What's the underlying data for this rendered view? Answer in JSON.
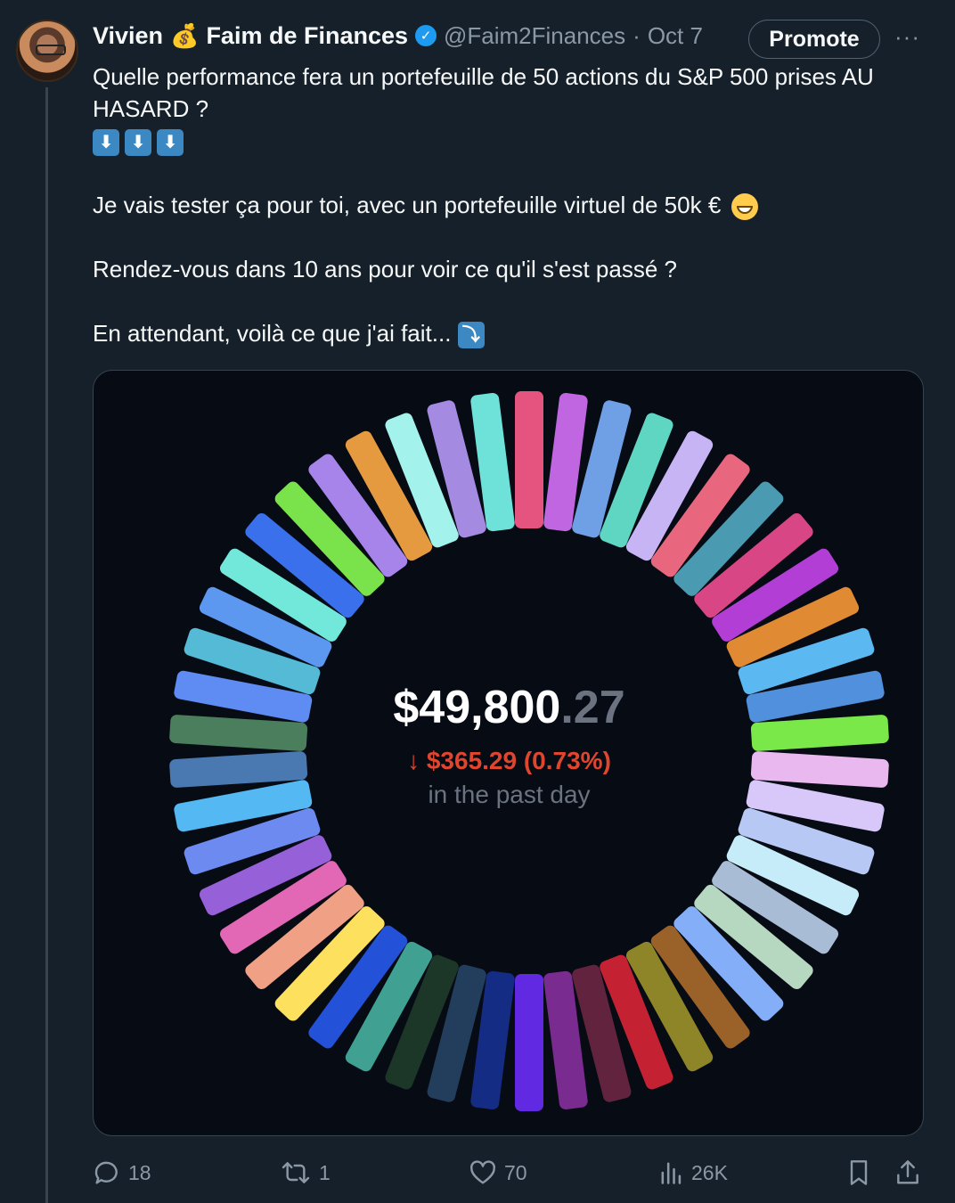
{
  "tweet": {
    "author": {
      "display_name": "Vivien",
      "brand_name": "Faim de Finances",
      "handle": "@Faim2Finances",
      "separator": "·",
      "date": "Oct 7"
    },
    "promote_label": "Promote",
    "more_label": "···",
    "text": {
      "line1": "Quelle performance fera un portefeuille de 50 actions du S&P 500 prises AU HASARD ?",
      "arrows": [
        "⬇",
        "⬇",
        "⬇"
      ],
      "line2": "Je vais tester ça pour toi, avec un portefeuille virtuel de 50k €",
      "line3": "Rendez-vous dans 10 ans pour voir ce qu'il s'est passé ?",
      "line4": "En attendant, voilà ce que j'ai fait...",
      "line4_emoji": "⤵"
    },
    "media": {
      "value_main": "$49,800",
      "value_cents": ".27",
      "change": "$365.29 (0.73%)",
      "change_direction": "down",
      "period": "in the past day",
      "ring_colors": [
        "#e5547f",
        "#c066e0",
        "#6fa0e6",
        "#5fd6c2",
        "#c7b4f5",
        "#e8677f",
        "#4a9ab2",
        "#d94686",
        "#b23ed6",
        "#e08a34",
        "#5bb8f0",
        "#5090dc",
        "#7be84a",
        "#e8b8ee",
        "#d8c8fa",
        "#b8c8f4",
        "#c6ecfa",
        "#a8bcd6",
        "#b6d8c0",
        "#84aef8",
        "#9a6128",
        "#8e8428",
        "#c42233",
        "#61233e",
        "#7a2b90",
        "#6129e2",
        "#142c84",
        "#233e5c",
        "#1c3628",
        "#40a192",
        "#2352d8",
        "#fde05e",
        "#f0a084",
        "#e267b4",
        "#9660d8",
        "#6d8af0",
        "#54b8f2",
        "#4a78b0",
        "#4b7e5c",
        "#5e8cf2",
        "#54bad6",
        "#5c98f0",
        "#72e8da",
        "#3a70ec",
        "#7ae24a",
        "#a784ea",
        "#e59a40",
        "#a4f2ec",
        "#a48ae0",
        "#6ee2d8"
      ]
    },
    "stats": {
      "replies": "18",
      "reposts": "1",
      "likes": "70",
      "views": "26K"
    }
  }
}
